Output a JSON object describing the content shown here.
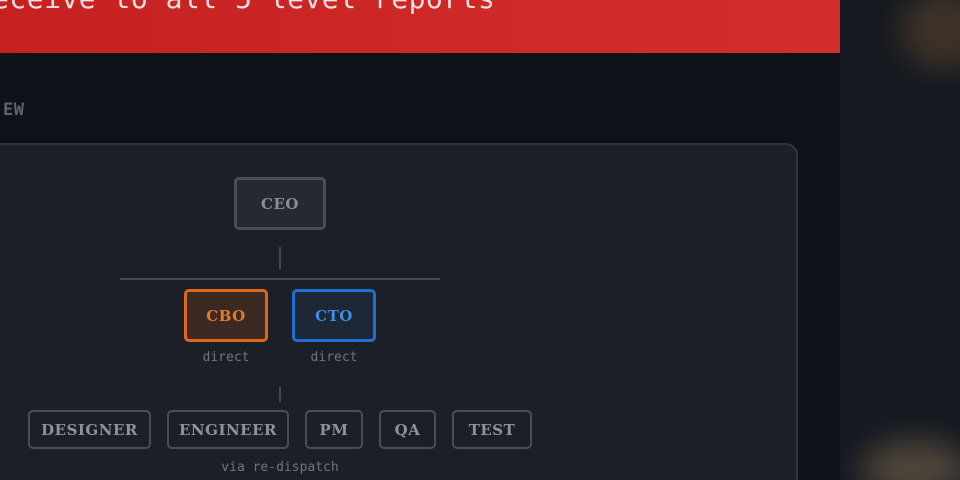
{
  "banner": {
    "text": "eceive to all 5 level reports"
  },
  "section": {
    "label": "EW"
  },
  "org_chart": {
    "root": {
      "label": "CEO"
    },
    "direct_reports": [
      {
        "label": "CBO",
        "caption": "direct",
        "color": "#e0661a"
      },
      {
        "label": "CTO",
        "caption": "direct",
        "color": "#1f6fd0"
      }
    ],
    "roles": [
      {
        "label": "DESIGNER"
      },
      {
        "label": "ENGINEER"
      },
      {
        "label": "PM"
      },
      {
        "label": "QA"
      },
      {
        "label": "TEST"
      }
    ],
    "roles_caption": "via re-dispatch"
  }
}
